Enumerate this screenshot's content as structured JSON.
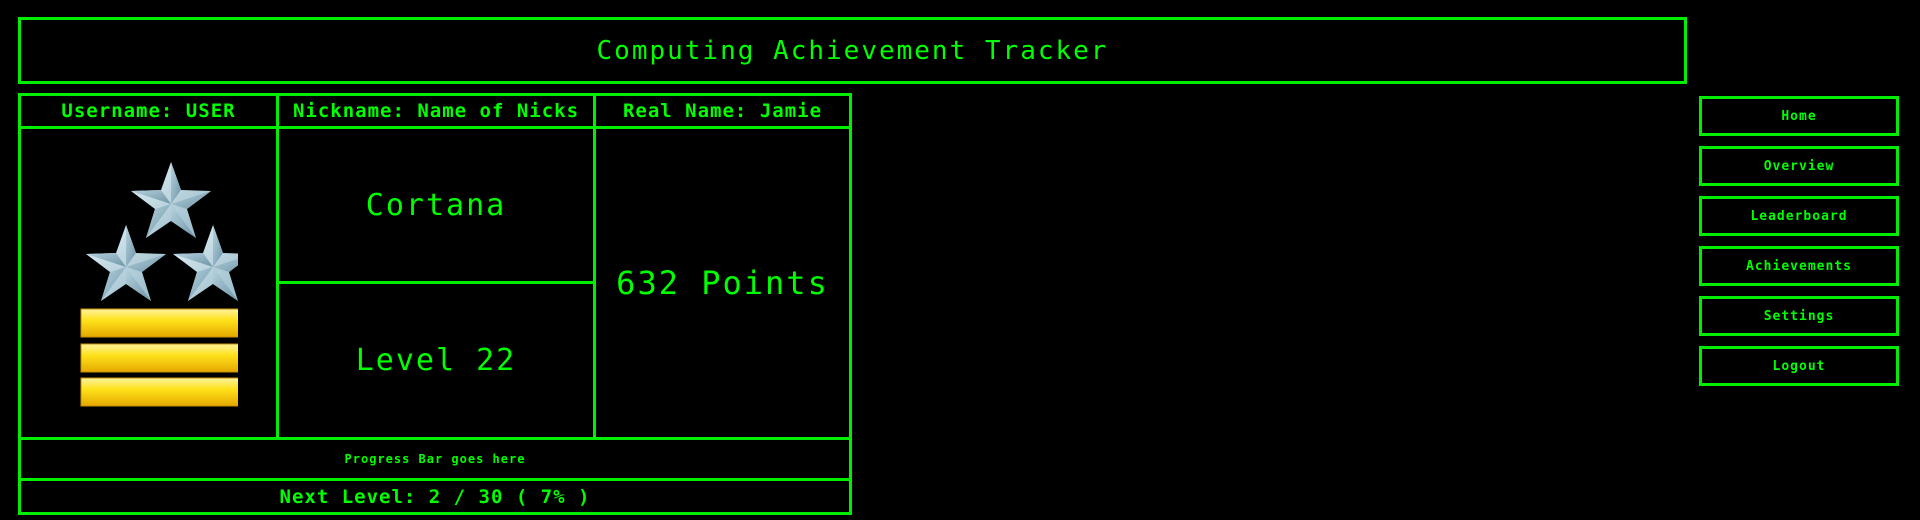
{
  "header": {
    "title": "Computing Achievement Tracker"
  },
  "profile": {
    "username_label": "Username: USER",
    "nickname_label": "Nickname: Name of Nicks",
    "realname_label": "Real Name: Jamie",
    "nickname": "Cortana",
    "level": "Level 22",
    "points": "632 Points"
  },
  "progress": {
    "placeholder": "Progress Bar goes here",
    "next_level": "Next Level: 2 / 30 ( 7% )"
  },
  "nav": {
    "items": [
      {
        "label": "Home"
      },
      {
        "label": "Overview"
      },
      {
        "label": "Leaderboard"
      },
      {
        "label": "Achievements"
      },
      {
        "label": "Settings"
      },
      {
        "label": "Logout"
      }
    ]
  },
  "colors": {
    "background": "#000000",
    "accent": "#00ff00",
    "star": "#bcd9e6",
    "bar": "#ffd700"
  },
  "icons": {
    "rank_badge": "rank-insignia-3-stars-3-bars"
  }
}
